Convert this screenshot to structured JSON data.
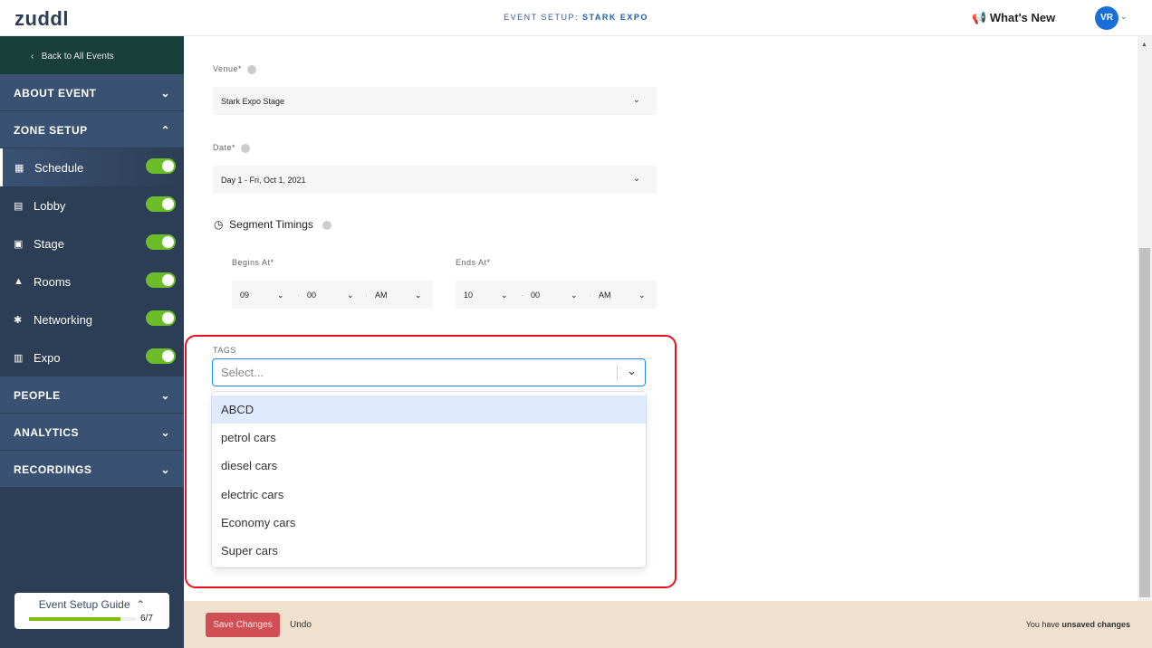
{
  "header": {
    "logo": "zuddl",
    "title_prefix": "EVENT SETUP:",
    "title_event": "STARK EXPO",
    "whats_new": "What's New",
    "avatar": "VR"
  },
  "sidebar": {
    "back": "Back to All Events",
    "sections": {
      "about": "ABOUT EVENT",
      "zone": "ZONE SETUP",
      "people": "PEOPLE",
      "analytics": "ANALYTICS",
      "recordings": "RECORDINGS"
    },
    "items": [
      {
        "label": "Schedule",
        "icon": "calendar-icon",
        "enabled": true
      },
      {
        "label": "Lobby",
        "icon": "lobby-icon",
        "enabled": true
      },
      {
        "label": "Stage",
        "icon": "stage-icon",
        "enabled": true
      },
      {
        "label": "Rooms",
        "icon": "rooms-icon",
        "enabled": true
      },
      {
        "label": "Networking",
        "icon": "networking-icon",
        "enabled": true
      },
      {
        "label": "Expo",
        "icon": "expo-icon",
        "enabled": true
      }
    ],
    "guide": {
      "label": "Event Setup Guide",
      "count": "6/7",
      "progress": 0.857
    }
  },
  "form": {
    "venue_label": "Venue*",
    "venue_value": "Stark Expo Stage",
    "date_label": "Date*",
    "date_value": "Day 1 - Fri, Oct 1, 2021",
    "segment_title": "Segment Timings",
    "begins_label": "Begins At*",
    "ends_label": "Ends At*",
    "begins": {
      "hour": "09",
      "minute": "00",
      "ampm": "AM"
    },
    "ends": {
      "hour": "10",
      "minute": "00",
      "ampm": "AM"
    },
    "tags_label": "TAGS",
    "tags_placeholder": "Select...",
    "tag_options": [
      "ABCD",
      "petrol cars",
      "diesel cars",
      "electric cars",
      "Economy cars",
      "Super cars"
    ]
  },
  "footer": {
    "save": "Save Changes",
    "undo": "Undo",
    "unsaved_prefix": "You have",
    "unsaved_bold": "unsaved changes"
  }
}
